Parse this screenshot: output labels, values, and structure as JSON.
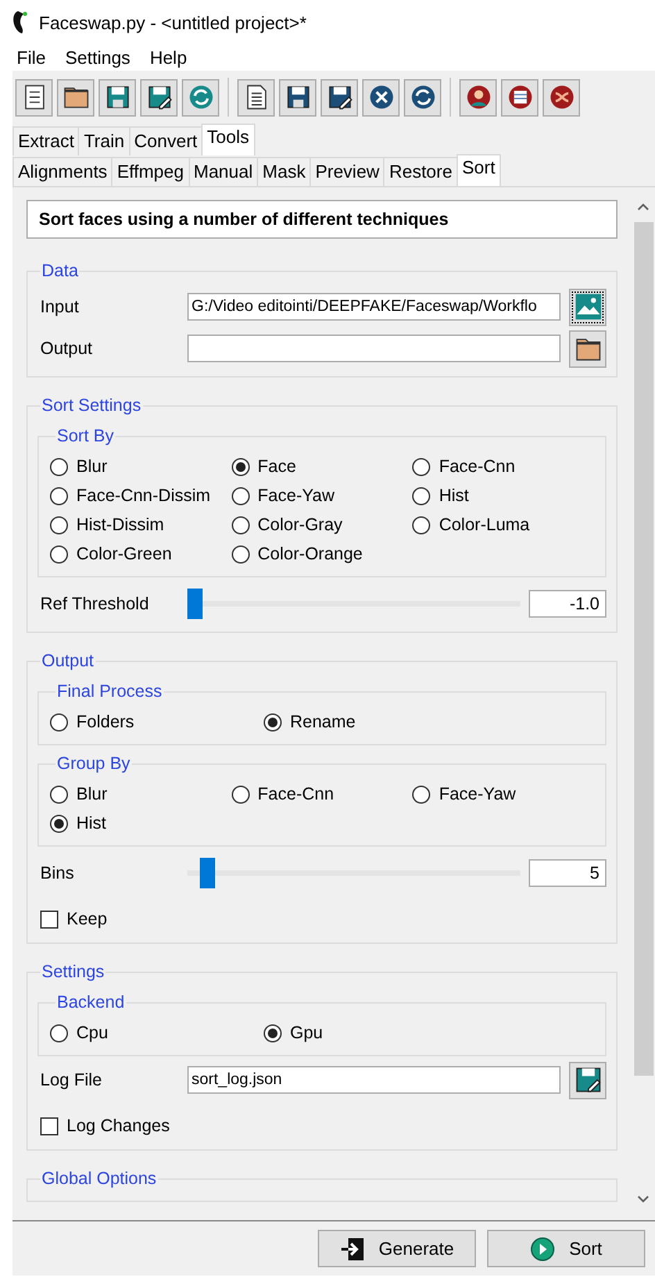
{
  "window": {
    "title": "Faceswap.py - <untitled project>*"
  },
  "menu": [
    "File",
    "Settings",
    "Help"
  ],
  "tabs": [
    {
      "label": "Extract",
      "selected": false
    },
    {
      "label": "Train",
      "selected": false
    },
    {
      "label": "Convert",
      "selected": false
    },
    {
      "label": "Tools",
      "selected": true
    }
  ],
  "subtabs": [
    {
      "label": "Alignments",
      "selected": false
    },
    {
      "label": "Effmpeg",
      "selected": false
    },
    {
      "label": "Manual",
      "selected": false
    },
    {
      "label": "Mask",
      "selected": false
    },
    {
      "label": "Preview",
      "selected": false
    },
    {
      "label": "Restore",
      "selected": false
    },
    {
      "label": "Sort",
      "selected": true
    }
  ],
  "description": "Sort faces using a number of different techniques",
  "sections": [
    {
      "title": "Data",
      "items": [
        {
          "kind": "imagefield",
          "label": "Input",
          "value": "G:/Video editointi/DEEPFAKE/Faceswap/Workflo"
        },
        {
          "kind": "folderfield",
          "label": "Output"
        }
      ]
    },
    {
      "title": "Sort Settings",
      "items": [
        {
          "kind": "radios",
          "title": "Sort By",
          "options": [
            {
              "label": "Blur",
              "selected": false
            },
            {
              "label": "Face",
              "selected": true
            },
            {
              "label": "Face-Cnn",
              "selected": false
            },
            {
              "label": "Face-Cnn-Dissim",
              "selected": false
            },
            {
              "label": "Face-Yaw",
              "selected": false
            },
            {
              "label": "Hist",
              "selected": false
            },
            {
              "label": "Hist-Dissim",
              "selected": false
            },
            {
              "label": "Color-Gray",
              "selected": false
            },
            {
              "label": "Color-Luma",
              "selected": false
            },
            {
              "label": "Color-Green",
              "selected": false
            },
            {
              "label": "Color-Orange",
              "selected": false
            }
          ]
        },
        {
          "kind": "slider",
          "label": "Ref Threshold",
          "level": 0,
          "value": "-1.0"
        }
      ]
    },
    {
      "title": "Output",
      "items": [
        {
          "kind": "radios",
          "title": "Final Process",
          "options": [
            {
              "label": "Folders",
              "selected": false
            },
            {
              "label": "Rename",
              "selected": true
            }
          ]
        },
        {
          "kind": "radios",
          "title": "Group By",
          "options": [
            {
              "label": "Blur",
              "selected": false
            },
            {
              "label": "Face-Cnn",
              "selected": false
            },
            {
              "label": "Face-Yaw",
              "selected": false
            },
            {
              "label": "Hist",
              "selected": true
            }
          ]
        },
        {
          "kind": "slider",
          "label": "Bins",
          "level": 0.04,
          "value": "5"
        },
        {
          "kind": "checkbox",
          "label": "Keep",
          "checked": false
        }
      ]
    },
    {
      "title": "Settings",
      "items": [
        {
          "kind": "radios",
          "title": "Backend",
          "options": [
            {
              "label": "Cpu",
              "selected": false
            },
            {
              "label": "Gpu",
              "selected": true
            }
          ]
        },
        {
          "kind": "savefield",
          "label": "Log File",
          "value": "sort_log.json"
        },
        {
          "kind": "checkbox",
          "label": "Log Changes",
          "checked": false
        }
      ]
    },
    {
      "title": "Global Options"
    }
  ],
  "buttons": [
    {
      "kind": "generate",
      "label": "Generate"
    },
    {
      "kind": "run",
      "label": "Sort"
    }
  ]
}
